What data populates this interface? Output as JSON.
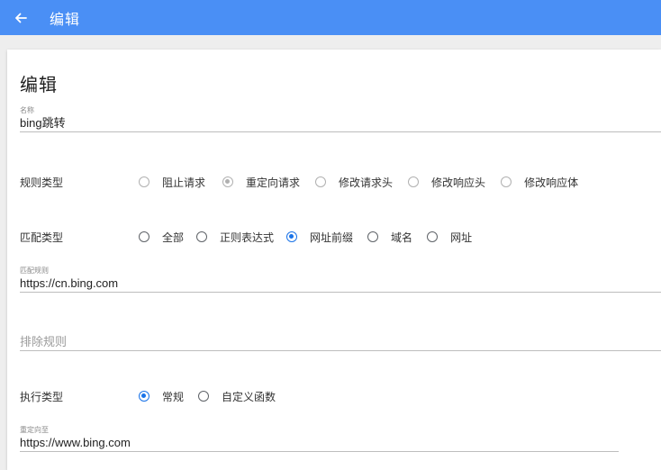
{
  "appbar": {
    "title": "编辑",
    "back_icon": "arrow-left-icon",
    "color": "#4a8ff5"
  },
  "card": {
    "title": "编辑"
  },
  "name_field": {
    "label": "名称",
    "value": "bing跳转"
  },
  "rule_type": {
    "label": "规则类型",
    "options": [
      "阻止请求",
      "重定向请求",
      "修改请求头",
      "修改响应头",
      "修改响应体"
    ],
    "selected": "重定向请求",
    "disabled": true
  },
  "match_type": {
    "label": "匹配类型",
    "options": [
      "全部",
      "正则表达式",
      "网址前缀",
      "域名",
      "网址"
    ],
    "selected": "网址前缀"
  },
  "match_rule": {
    "label": "匹配规则",
    "value": "https://cn.bing.com"
  },
  "exclude_rule": {
    "placeholder": "排除规则"
  },
  "exec_type": {
    "label": "执行类型",
    "options": [
      "常规",
      "自定义函数"
    ],
    "selected": "常规"
  },
  "redirect_to": {
    "label": "重定向至",
    "value": "https://www.bing.com"
  },
  "accent_color": "#1a73e8"
}
